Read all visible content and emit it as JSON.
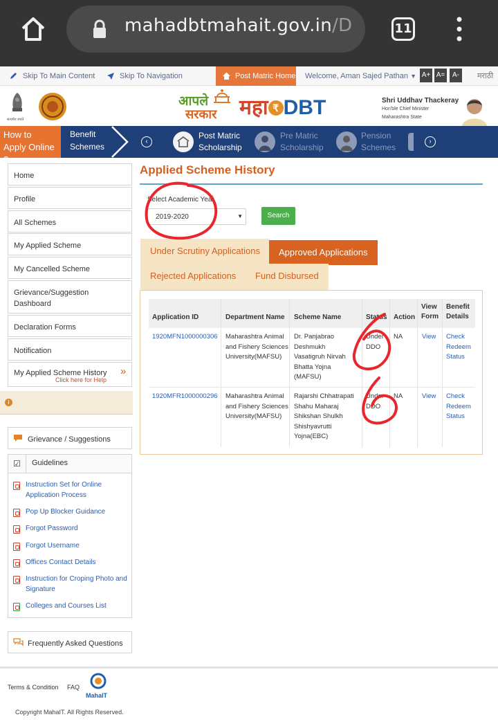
{
  "browser": {
    "url_main": "mahadbtmahait.gov.in",
    "url_tail": "/D",
    "tab_count": "11"
  },
  "topbar": {
    "skip_main": "Skip To Main Content",
    "skip_nav": "Skip To Navigation",
    "home": "Post Matric Home",
    "welcome": "Welcome, Aman Sajed Pathan",
    "font_buttons": [
      "A+",
      "A=",
      "A-"
    ],
    "language": "मराठी"
  },
  "header": {
    "emblem_caption": "सत्यमेव जयते",
    "logo_aaple": "आपले",
    "logo_sarkar": "सरकार",
    "logo_maha": "महा",
    "logo_dbt": "DBT",
    "minister_name": "Shri Uddhav Thackeray",
    "minister_title1": "Hon'ble Chief Minister",
    "minister_title2": "Maharashtra State"
  },
  "nav": {
    "how_to_line1": "How to",
    "how_to_line2": "Apply Online ?",
    "benefit_line1": "Benefit",
    "benefit_line2": "Schemes",
    "items": [
      {
        "line1": "Post Matric",
        "line2": "Scholarship"
      },
      {
        "line1": "Pre Matric",
        "line2": "Scholarship"
      },
      {
        "line1": "Pension",
        "line2": "Schemes"
      }
    ]
  },
  "sidebar": {
    "items": [
      "Home",
      "Profile",
      "All Schemes",
      "My Applied Scheme",
      "My Cancelled Scheme",
      "Grievance/Suggestion Dashboard",
      "Declaration Forms",
      "Notification",
      "My Applied Scheme History"
    ],
    "help_text": "Click here for Help",
    "grievance": "Grievance / Suggestions",
    "guidelines_title": "Guidelines",
    "guidelines": [
      "Instruction Set for Online Application Process",
      "Pop Up Blocker Guidance",
      "Forgot Password",
      "Forgot Username",
      "Offices Contact Details",
      "Instruction for Croping Photo and Signature",
      "Colleges and Courses List"
    ],
    "faq": "Frequently Asked Questions"
  },
  "main": {
    "title": "Applied Scheme History",
    "year_label": "Select Academic Year",
    "year_value": "2019-2020",
    "search_button": "Search",
    "tabs": [
      "Under Scrutiny Applications",
      "Approved Applications",
      "Rejected Applications",
      "Fund Disbursed"
    ],
    "table": {
      "headers": {
        "app_id": "Application ID",
        "dept": "Department Name",
        "scheme": "Scheme Name",
        "status": "Status",
        "action": "Action",
        "view_form": "View Form",
        "benefit": "Benefit Details"
      },
      "rows": [
        {
          "app_id": "1920MFN1000000306",
          "dept": "Maharashtra Animal and Fishery Sciences University(MAFSU)",
          "scheme": "Dr. Panjabrao Deshmukh Vasatigruh Nirvah Bhatta Yojna (MAFSU)",
          "status": "Under DDO",
          "action": "NA",
          "view": "View",
          "benefit": "Check Redeem Status"
        },
        {
          "app_id": "1920MFR1000000296",
          "dept": "Maharashtra Animal and Fishery Sciences University(MAFSU)",
          "scheme": "Rajarshi Chhatrapati Shahu Maharaj Shikshan Shulkh Shishyavrutti Yojna(EBC)",
          "status": "Under DDO",
          "action": "NA",
          "view": "View",
          "benefit": "Check Redeem Status"
        }
      ]
    }
  },
  "footer": {
    "terms": "Terms & Condition",
    "faq": "FAQ",
    "logo_text": "MahaIT",
    "copyright": "Copyright MahaIT. All Rights Reserved."
  },
  "colors": {
    "accent_orange": "#e6773a",
    "nav_blue": "#1e3f78",
    "link_blue": "#2a5db0",
    "annotation_red": "#e8262c"
  }
}
